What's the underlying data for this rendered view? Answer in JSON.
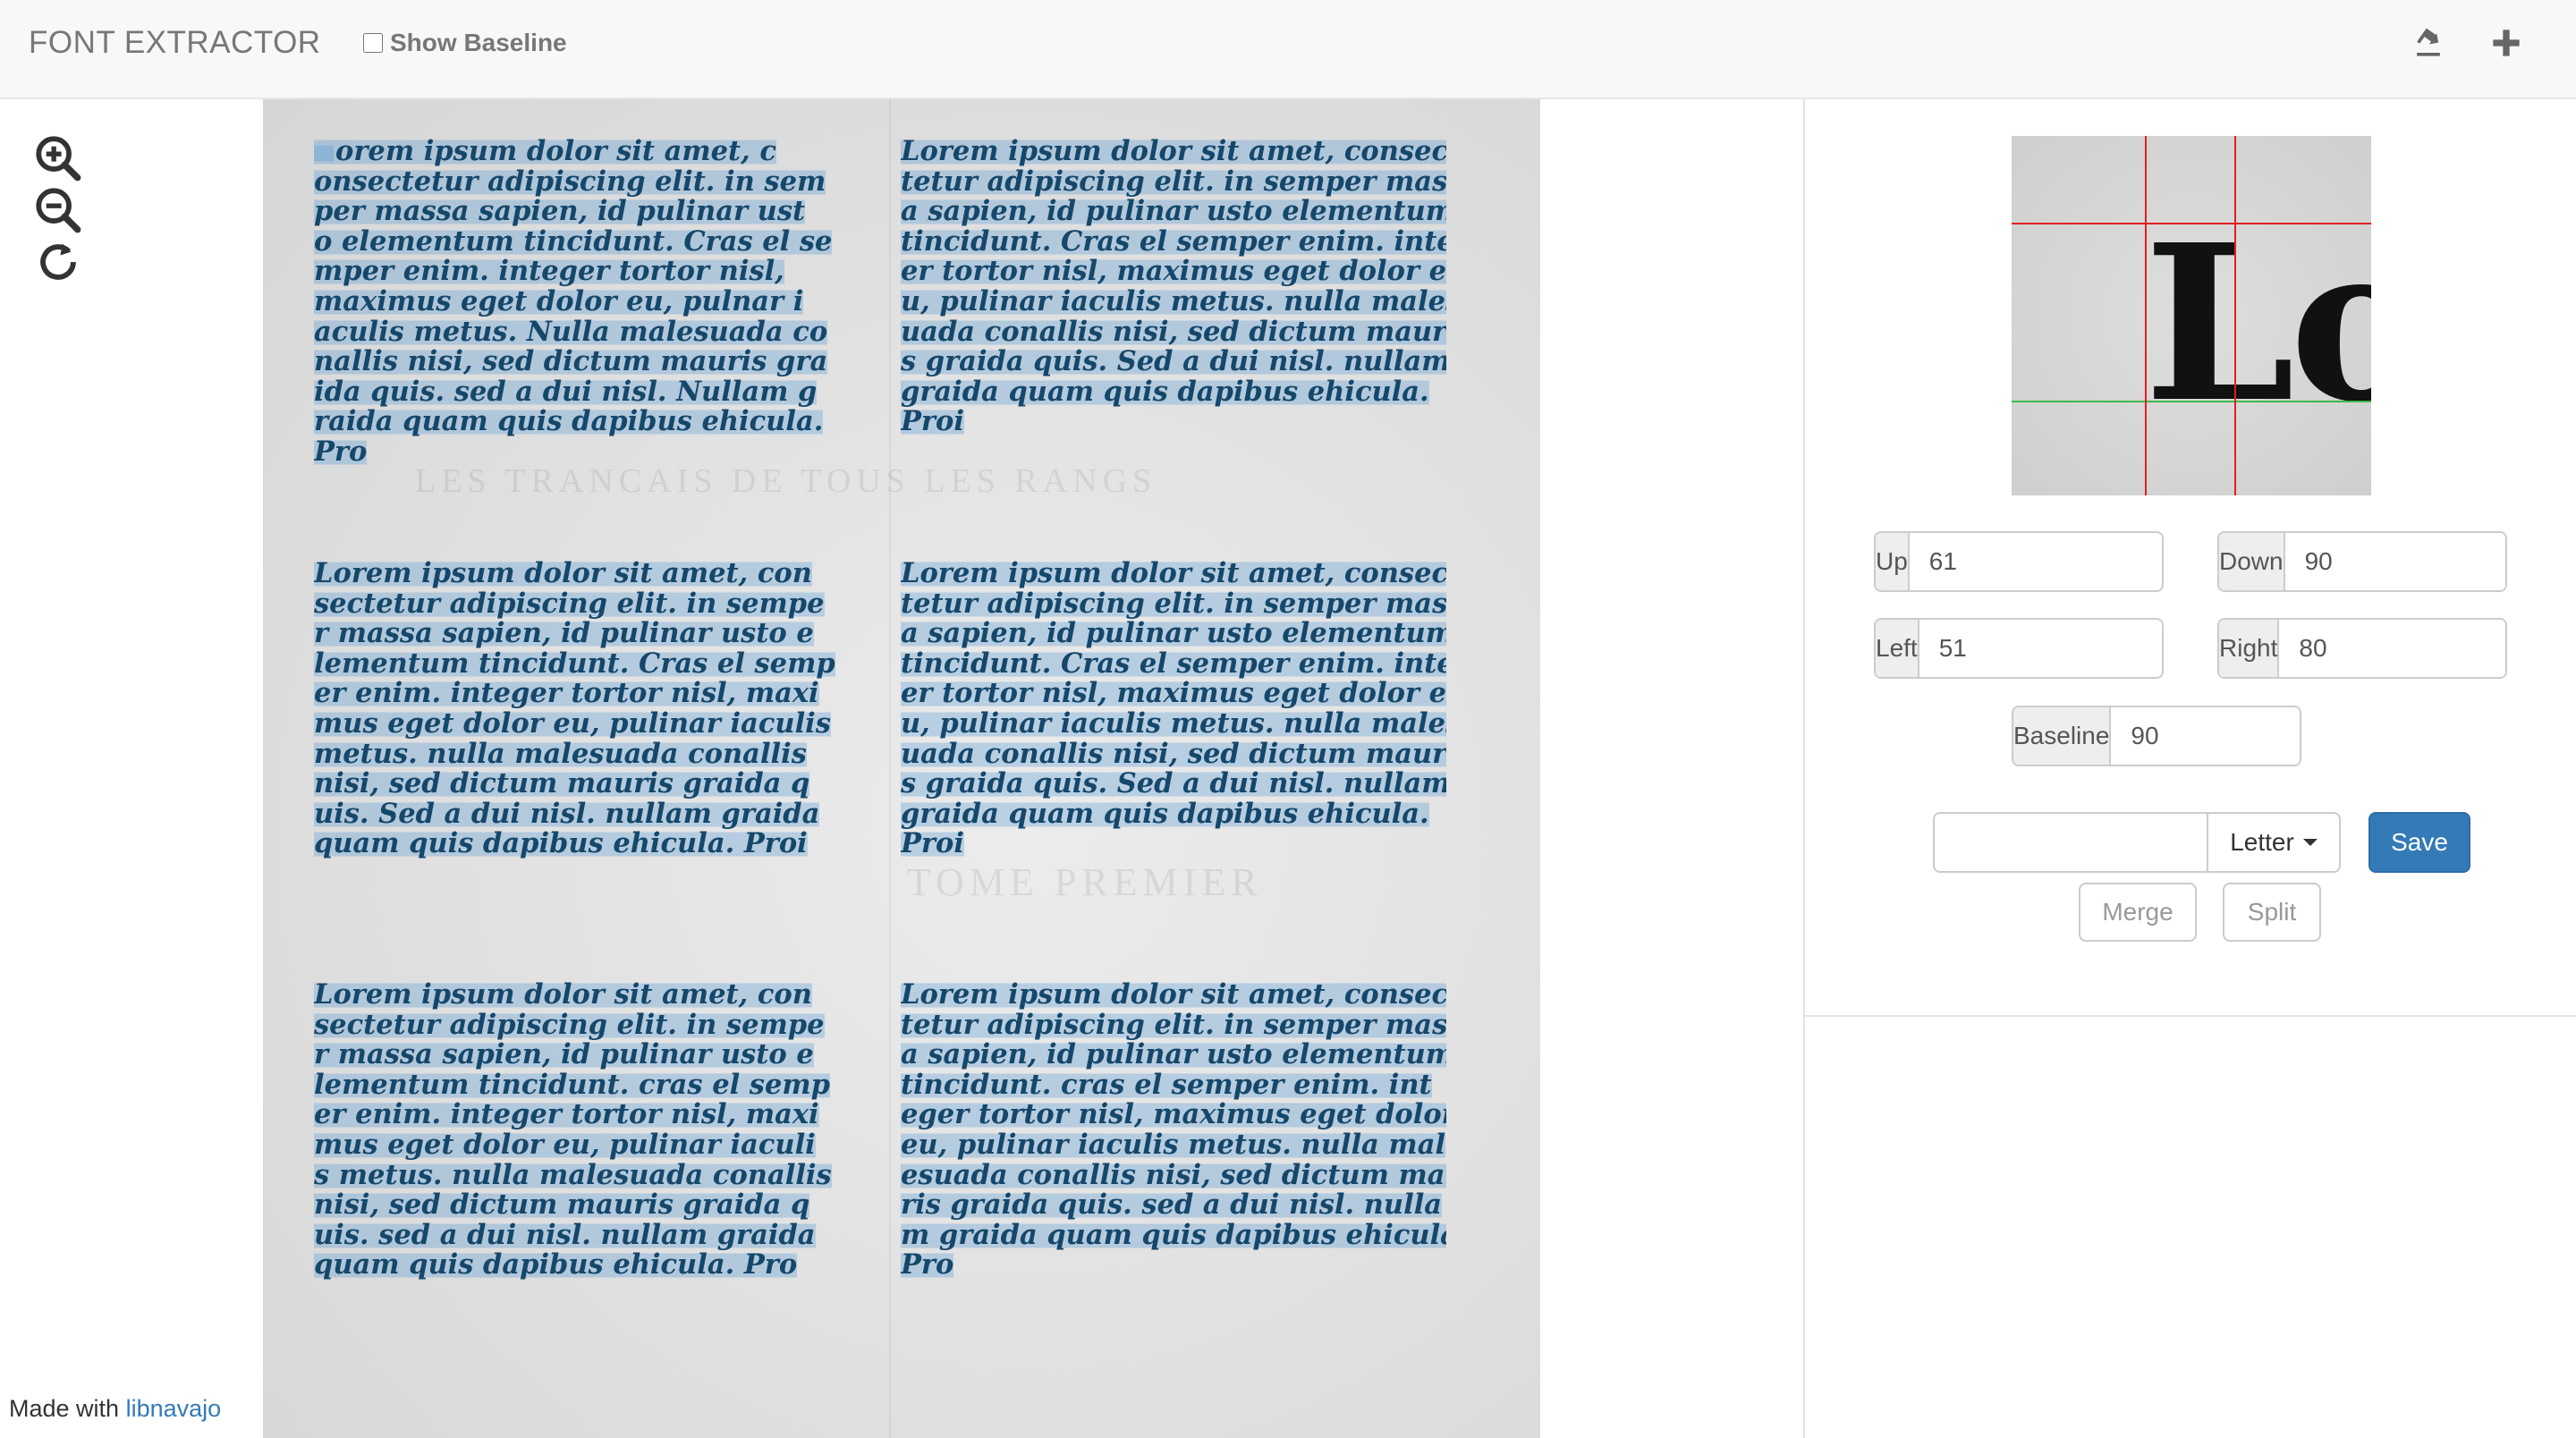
{
  "navbar": {
    "brand": "FONT EXTRACTOR",
    "show_baseline_label": "Show Baseline",
    "show_baseline_checked": false,
    "icons": [
      "export-icon",
      "plus-icon"
    ]
  },
  "tools": [
    "zoom-in-icon",
    "zoom-out-icon",
    "refresh-icon"
  ],
  "footer": {
    "prefix": "Made with",
    "link_text": "libnavajo"
  },
  "document": {
    "columns": [
      {
        "lines": [
          "Lorem ipsum dolor sit amet, c",
          "onsectetur adipiscing elit. in sem",
          "per massa sapien, id pulinar ust",
          "o elementum tincidunt. Cras el se",
          "mper enim. integer tortor nisl,",
          "maximus eget dolor eu, pulnar i",
          "aculis metus. Nulla malesuada co",
          "nallis nisi, sed dictum mauris gra",
          "ida quis. sed a dui nisl. Nullam g",
          "raida quam quis dapibus ehicula.",
          "Pro"
        ]
      },
      {
        "lines": [
          "Lorem ipsum dolor sit amet, consec",
          "tetur adipiscing elit. in semper mass",
          "a sapien, id pulinar usto elementum",
          "tincidunt. Cras el semper enim. integ",
          "er tortor nisl, maximus eget dolor e",
          "u, pulinar iaculis metus. nulla males",
          "uada conallis nisi, sed dictum mauri",
          "s graida quis. Sed a dui nisl. nullam",
          "graida quam quis dapibus ehicula.",
          "Proi"
        ]
      },
      {
        "lines": [
          "Lorem ipsum dolor sit amet, con",
          "sectetur adipiscing elit. in sempe",
          "r massa sapien, id pulinar usto e",
          "lementum tincidunt. Cras el semp",
          "er enim. integer tortor nisl, maxi",
          "mus eget dolor eu, pulinar iaculis",
          "metus. nulla malesuada conallis",
          "nisi, sed dictum mauris graida q",
          "uis. Sed a dui nisl. nullam graida",
          "quam quis dapibus ehicula. Proi"
        ]
      },
      {
        "lines": [
          "Lorem ipsum dolor sit amet, consec",
          "tetur adipiscing elit. in semper mass",
          "a sapien, id pulinar usto elementum",
          "tincidunt. Cras el semper enim. integ",
          "er tortor nisl, maximus eget dolor e",
          "u, pulinar iaculis metus. nulla males",
          "uada conallis nisi, sed dictum mauri",
          "s graida quis. Sed a dui nisl. nullam",
          "graida quam quis dapibus ehicula.",
          "Proi"
        ]
      },
      {
        "lines": [
          "Lorem ipsum dolor sit amet, con",
          "sectetur adipiscing elit. in sempe",
          "r massa sapien, id pulinar usto e",
          "lementum tincidunt. cras el semp",
          "er enim. integer tortor nisl, maxi",
          "mus eget dolor eu, pulinar iaculi",
          "s metus. nulla malesuada conallis",
          "nisi, sed dictum mauris graida q",
          "uis. sed a dui nisl. nullam graida",
          "quam quis dapibus ehicula. Pro"
        ]
      },
      {
        "lines": [
          "Lorem ipsum dolor sit amet, consec",
          "tetur adipiscing elit. in semper mass",
          "a sapien, id pulinar usto elementum",
          "tincidunt. cras el semper enim. int",
          "eger tortor nisl, maximus eget dolor",
          "eu, pulinar iaculis metus. nulla mal",
          "esuada conallis nisi, sed dictum mau",
          "ris graida quis. sed a dui nisl. nulla",
          "m graida quam quis dapibus ehicula.",
          "Pro"
        ]
      }
    ]
  },
  "preview": {
    "glyph_text": "Lore"
  },
  "params": {
    "up": {
      "label": "Up",
      "value": "61"
    },
    "down": {
      "label": "Down",
      "value": "90"
    },
    "left": {
      "label": "Left",
      "value": "51"
    },
    "right": {
      "label": "Right",
      "value": "80"
    },
    "baseline": {
      "label": "Baseline",
      "value": "90"
    }
  },
  "actions": {
    "glyph_value": "",
    "type_label": "Letter",
    "save_label": "Save",
    "merge_label": "Merge",
    "split_label": "Split"
  },
  "colors": {
    "primary": "#337ab7",
    "guide_red": "#e02020",
    "guide_green": "#3cb84a",
    "text_blue": "#15476b"
  }
}
